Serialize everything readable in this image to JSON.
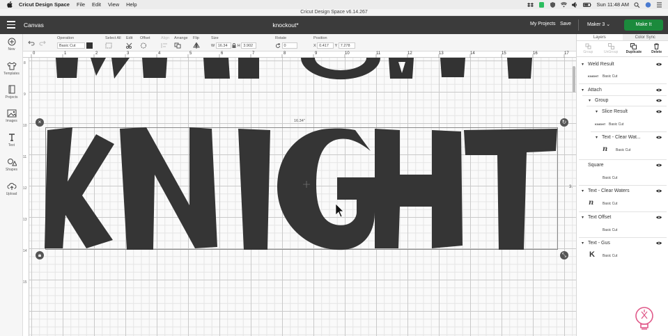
{
  "menubar": {
    "app_name": "Cricut Design Space",
    "items": [
      "File",
      "Edit",
      "View",
      "Help"
    ],
    "clock": "Sun 11:48 AM"
  },
  "window_title": "Cricut Design Space  v6.14.267",
  "header": {
    "section": "Canvas",
    "project_name": "knockout*",
    "my_projects": "My Projects",
    "save": "Save",
    "machine": "Maker 3",
    "make_it": "Make It"
  },
  "toolbar": {
    "operation_label": "Operation",
    "operation_value": "Basic Cut",
    "select_all": "Select All",
    "edit": "Edit",
    "offset": "Offset",
    "align": "Align",
    "arrange": "Arrange",
    "flip": "Flip",
    "size_label": "Size",
    "size_w_label": "W",
    "size_w": "16.34",
    "size_h_label": "H",
    "size_h": "3.902",
    "rotate_label": "Rotate",
    "rotate": "0",
    "position_label": "Position",
    "pos_x_label": "X",
    "pos_x": "0.417",
    "pos_y_label": "Y",
    "pos_y": "7.278"
  },
  "leftrail": [
    "New",
    "Templates",
    "Projects",
    "Images",
    "Text",
    "Shapes",
    "Upload"
  ],
  "ruler_top": [
    "0",
    "1",
    "2",
    "3",
    "4",
    "5",
    "6",
    "7",
    "8",
    "9",
    "10",
    "11",
    "12",
    "13",
    "14",
    "15",
    "16",
    "17"
  ],
  "ruler_left": [
    "8",
    "9",
    "10",
    "11",
    "12",
    "13",
    "14",
    "15"
  ],
  "canvas": {
    "width_label": "16.34\"",
    "side_label": "3.",
    "main_text": "KNIGHT"
  },
  "panel": {
    "tabs": [
      "Layers",
      "Color Sync"
    ],
    "actions": [
      "Group",
      "UnGroup",
      "Duplicate",
      "Delete"
    ],
    "layers": [
      {
        "name": "Weld Result",
        "sub": "Basic Cut",
        "thumb": "KNIGHT"
      },
      {
        "name": "Attach"
      },
      {
        "name": "Group"
      },
      {
        "name": "Slice Result",
        "sub": "Basic Cut",
        "thumb": "KNIGHT"
      },
      {
        "name": "Text - Clear Wat...",
        "sub": "Basic Cut",
        "thumb": "n"
      },
      {
        "name": "Square",
        "sub": "Basic Cut"
      },
      {
        "name": "Text - Clear Waters",
        "sub": "Basic Cut",
        "thumb": "n"
      },
      {
        "name": "Text Offset",
        "sub": "Basic Cut"
      },
      {
        "name": "Text - Gus",
        "sub": "Basic Cut",
        "thumb": "K"
      }
    ]
  },
  "colors": {
    "header_bg": "#3b3b3b",
    "make_it": "#1b8a3c",
    "letters": "#333333",
    "accent_logo": "#e05a8a"
  }
}
